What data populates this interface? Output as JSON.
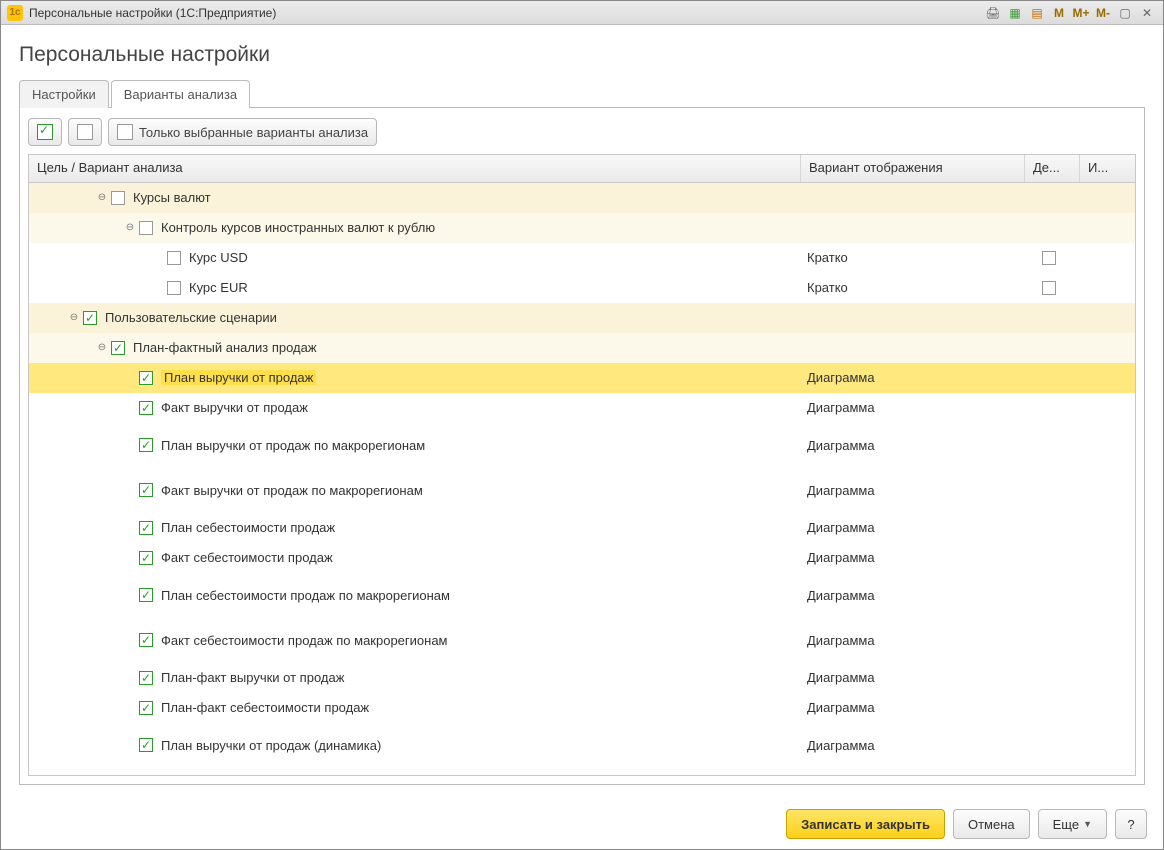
{
  "window": {
    "app_logo_text": "1c",
    "title": "Персональные настройки  (1С:Предприятие)",
    "tb_icons": [
      "print-icon",
      "grid-icon",
      "calendar-icon",
      "M",
      "M+",
      "M-",
      "maximize-icon",
      "close-icon"
    ]
  },
  "page": {
    "title": "Персональные настройки"
  },
  "tabs": [
    {
      "id": "settings",
      "label": "Настройки",
      "active": false
    },
    {
      "id": "variants",
      "label": "Варианты анализа",
      "active": true
    }
  ],
  "toolbar": {
    "btn_select_all_title": "Выбрать все",
    "btn_unselect_all_title": "Снять все",
    "btn_only_selected_label": "Только выбранные варианты анализа"
  },
  "grid": {
    "headers": {
      "col1": "Цель / Вариант анализа",
      "col2": "Вариант отображения",
      "col3": "Де...",
      "col4": "И..."
    },
    "rows": [
      {
        "level": 1,
        "group": 0,
        "expander": true,
        "checked": false,
        "label": "Курсы валют",
        "display": "",
        "col3_cb": null,
        "tall": false
      },
      {
        "level": 2,
        "group": 1,
        "expander": true,
        "checked": false,
        "label": "Контроль курсов иностранных валют к рублю",
        "display": "",
        "col3_cb": null,
        "tall": false
      },
      {
        "level": 3,
        "group": null,
        "expander": false,
        "checked": false,
        "label": "Курс USD",
        "display": "Кратко",
        "col3_cb": false,
        "tall": false
      },
      {
        "level": 3,
        "group": null,
        "expander": false,
        "checked": false,
        "label": "Курс EUR",
        "display": "Кратко",
        "col3_cb": false,
        "tall": false
      },
      {
        "level": 0,
        "group": 0,
        "expander": true,
        "checked": true,
        "label": "Пользовательские сценарии",
        "display": "",
        "col3_cb": null,
        "tall": false
      },
      {
        "level": 1,
        "group": 1,
        "expander": true,
        "checked": true,
        "label": "План-фактный анализ продаж",
        "display": "",
        "col3_cb": null,
        "tall": false
      },
      {
        "level": 2,
        "group": null,
        "expander": false,
        "checked": true,
        "label": "План выручки от продаж",
        "display": "Диаграмма",
        "col3_cb": null,
        "tall": false,
        "selected": true
      },
      {
        "level": 2,
        "group": null,
        "expander": false,
        "checked": true,
        "label": "Факт выручки от продаж",
        "display": "Диаграмма",
        "col3_cb": null,
        "tall": false
      },
      {
        "level": 2,
        "group": null,
        "expander": false,
        "checked": true,
        "label": "План выручки от продаж по макрорегионам",
        "display": "Диаграмма",
        "col3_cb": null,
        "tall": true
      },
      {
        "level": 2,
        "group": null,
        "expander": false,
        "checked": true,
        "label": "Факт выручки от продаж по макрорегионам",
        "display": "Диаграмма",
        "col3_cb": null,
        "tall": true
      },
      {
        "level": 2,
        "group": null,
        "expander": false,
        "checked": true,
        "label": "План себестоимости продаж",
        "display": "Диаграмма",
        "col3_cb": null,
        "tall": false
      },
      {
        "level": 2,
        "group": null,
        "expander": false,
        "checked": true,
        "label": "Факт себестоимости продаж",
        "display": "Диаграмма",
        "col3_cb": null,
        "tall": false
      },
      {
        "level": 2,
        "group": null,
        "expander": false,
        "checked": true,
        "label": "План себестоимости продаж по макрорегионам",
        "display": "Диаграмма",
        "col3_cb": null,
        "tall": true
      },
      {
        "level": 2,
        "group": null,
        "expander": false,
        "checked": true,
        "label": "Факт себестоимости продаж по макрорегионам",
        "display": "Диаграмма",
        "col3_cb": null,
        "tall": true
      },
      {
        "level": 2,
        "group": null,
        "expander": false,
        "checked": true,
        "label": "План-факт выручки от продаж",
        "display": "Диаграмма",
        "col3_cb": null,
        "tall": false
      },
      {
        "level": 2,
        "group": null,
        "expander": false,
        "checked": true,
        "label": "План-факт себестоимости продаж",
        "display": "Диаграмма",
        "col3_cb": null,
        "tall": false
      },
      {
        "level": 2,
        "group": null,
        "expander": false,
        "checked": true,
        "label": "План выручки от продаж (динамика)",
        "display": "Диаграмма",
        "col3_cb": null,
        "tall": true
      }
    ]
  },
  "footer": {
    "save_and_close": "Записать и закрыть",
    "cancel": "Отмена",
    "more": "Еще",
    "help": "?"
  }
}
